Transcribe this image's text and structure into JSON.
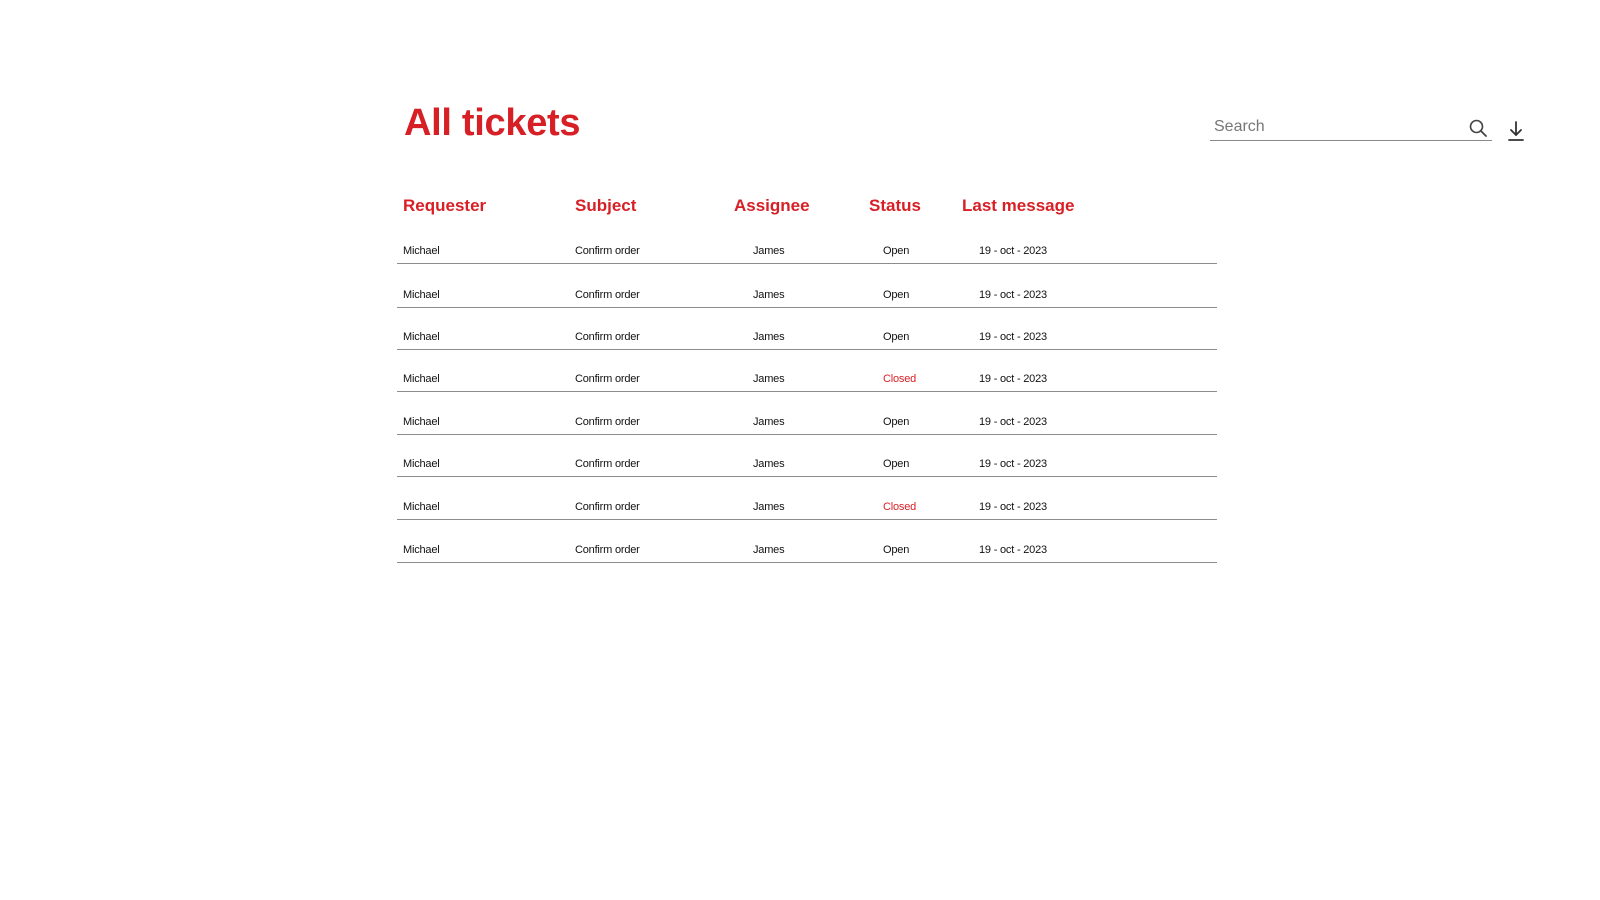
{
  "page": {
    "title": "All tickets"
  },
  "search": {
    "placeholder": "Search",
    "value": ""
  },
  "icons": {
    "search": "search-icon",
    "download": "download-icon"
  },
  "colors": {
    "accent": "#d71f26",
    "text": "#111111",
    "divider": "#8c8c8c"
  },
  "table": {
    "columns": [
      "Requester",
      "Subject",
      "Assignee",
      "Status",
      "Last message"
    ],
    "rows": [
      {
        "requester": "Michael",
        "subject": "Confirm order",
        "assignee": "James",
        "status": "Open",
        "last_message": "19 - oct - 2023"
      },
      {
        "requester": "Michael",
        "subject": "Confirm order",
        "assignee": "James",
        "status": "Open",
        "last_message": "19 - oct - 2023"
      },
      {
        "requester": "Michael",
        "subject": "Confirm order",
        "assignee": "James",
        "status": "Open",
        "last_message": "19 - oct - 2023"
      },
      {
        "requester": "Michael",
        "subject": "Confirm order",
        "assignee": "James",
        "status": "Closed",
        "last_message": "19 - oct - 2023"
      },
      {
        "requester": "Michael",
        "subject": "Confirm order",
        "assignee": "James",
        "status": "Open",
        "last_message": "19 - oct - 2023"
      },
      {
        "requester": "Michael",
        "subject": "Confirm order",
        "assignee": "James",
        "status": "Open",
        "last_message": "19 - oct - 2023"
      },
      {
        "requester": "Michael",
        "subject": "Confirm order",
        "assignee": "James",
        "status": "Closed",
        "last_message": "19 - oct - 2023"
      },
      {
        "requester": "Michael",
        "subject": "Confirm order",
        "assignee": "James",
        "status": "Open",
        "last_message": "19 - oct - 2023"
      }
    ]
  }
}
